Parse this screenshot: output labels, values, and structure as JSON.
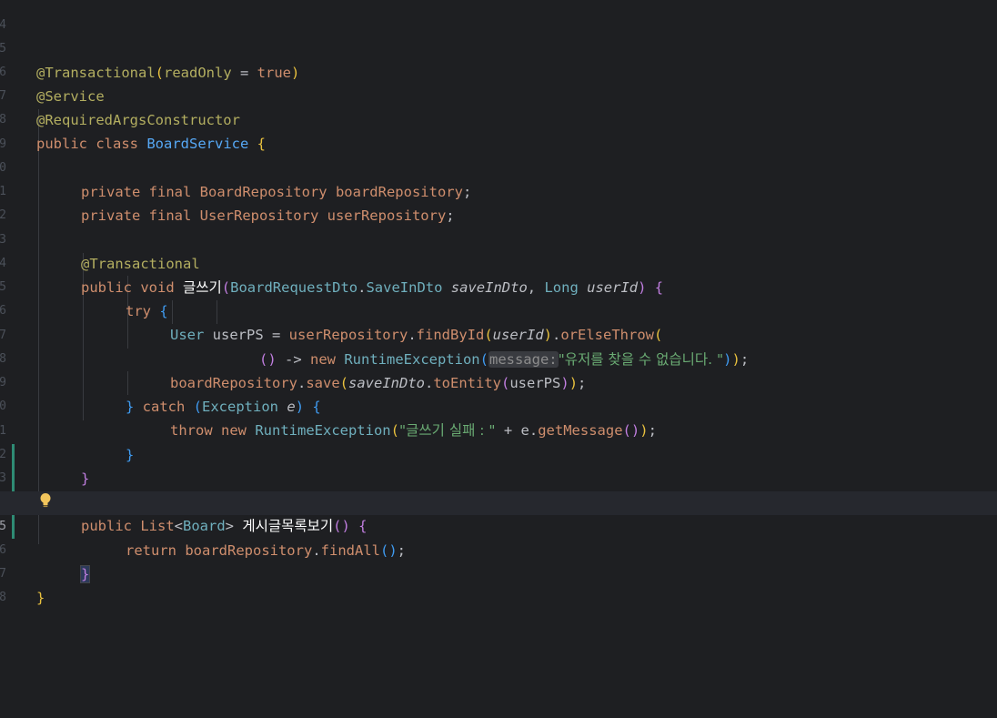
{
  "editor": {
    "line_numbers": [
      "4",
      "5",
      "6",
      "7",
      "8",
      "9",
      "0",
      "1",
      "2",
      "3",
      "4",
      "5",
      "6",
      "7",
      "8",
      "9",
      "0",
      "1",
      "2",
      "3",
      "4",
      "5",
      "6",
      "7",
      "8"
    ],
    "current_line_number": "5",
    "lines": {
      "l5_at": "@",
      "l5_ann": "Transactional",
      "l5_open": "(",
      "l5_attr": "readOnly",
      "l5_eq": " = ",
      "l5_true": "true",
      "l5_close": ")",
      "l6_at": "@",
      "l6_ann": "Service",
      "l7_at": "@",
      "l7_ann": "RequiredArgsConstructor",
      "l8_public": "public ",
      "l8_class": "class ",
      "l8_name": "BoardService",
      "l8_brace": " {",
      "l10_private": "private ",
      "l10_final": "final ",
      "l10_type": "BoardRepository",
      "l10_name": " boardRepository",
      "l10_semi": ";",
      "l11_private": "private ",
      "l11_final": "final ",
      "l11_type": "UserRepository",
      "l11_name": " userRepository",
      "l11_semi": ";",
      "l13_at": "@",
      "l13_ann": "Transactional",
      "l14_public": "public ",
      "l14_void": "void ",
      "l14_method": "글쓰기",
      "l14_open": "(",
      "l14_type1": "BoardRequestDto",
      "l14_dot": ".",
      "l14_type2": "SaveInDto",
      "l14_p1": " saveInDto",
      "l14_comma": ", ",
      "l14_type3": "Long",
      "l14_p2": " userId",
      "l14_close": ")",
      "l14_brace": " {",
      "l15_try": "try",
      "l15_brace": " {",
      "l16_type": "User",
      "l16_var": " userPS = ",
      "l16_repo": "userRepository",
      "l16_dot1": ".",
      "l16_find": "findById",
      "l16_open": "(",
      "l16_arg": "userId",
      "l16_close": ")",
      "l16_dot2": ".",
      "l16_or": "orElseThrow",
      "l16_open2": "(",
      "l17_lambda_open": "()",
      "l17_arrow": " -> ",
      "l17_new": "new ",
      "l17_exc": "RuntimeException",
      "l17_open": "(",
      "l17_hint": "message:",
      "l17_str": "\"유저를 찾을 수 없습니다. \"",
      "l17_close1": ")",
      "l17_close2": ")",
      "l17_semi": ";",
      "l18_repo": "boardRepository",
      "l18_dot": ".",
      "l18_save": "save",
      "l18_open": "(",
      "l18_arg": "saveInDto",
      "l18_dot2": ".",
      "l18_to": "toEntity",
      "l18_open2": "(",
      "l18_arg2": "userPS",
      "l18_close2": ")",
      "l18_close": ")",
      "l18_semi": ";",
      "l19_brace": "}",
      "l19_catch": " catch ",
      "l19_open": "(",
      "l19_type": "Exception",
      "l19_e": " e",
      "l19_close": ")",
      "l19_brace2": " {",
      "l20_throw": "throw ",
      "l20_new": "new ",
      "l20_exc": "RuntimeException",
      "l20_open": "(",
      "l20_str": "\"글쓰기 실패 : \"",
      "l20_plus": " + e.",
      "l20_get": "getMessage",
      "l20_call": "()",
      "l20_close": ")",
      "l20_semi": ";",
      "l21_brace": "}",
      "l22_brace": "}",
      "l24_public": "public ",
      "l24_list": "List",
      "l24_lt": "<",
      "l24_board": "Board",
      "l24_gt": "> ",
      "l24_method": "게시글목록보기",
      "l24_call": "()",
      "l24_brace": " {",
      "l25_return": "return ",
      "l25_repo": "boardRepository",
      "l25_dot": ".",
      "l25_find": "findAll",
      "l25_call": "()",
      "l25_semi": ";",
      "l26_brace": "}",
      "l27_brace": "}"
    }
  },
  "icons": {
    "intention_bulb": "lightbulb-icon"
  },
  "colors": {
    "background": "#1e1f22",
    "keyword": "#cf8e6d",
    "annotation": "#b3ae60",
    "method": "#56a8f5",
    "string": "#6aab73",
    "field": "#c77dbb",
    "vcs_added": "#2e8b74"
  }
}
